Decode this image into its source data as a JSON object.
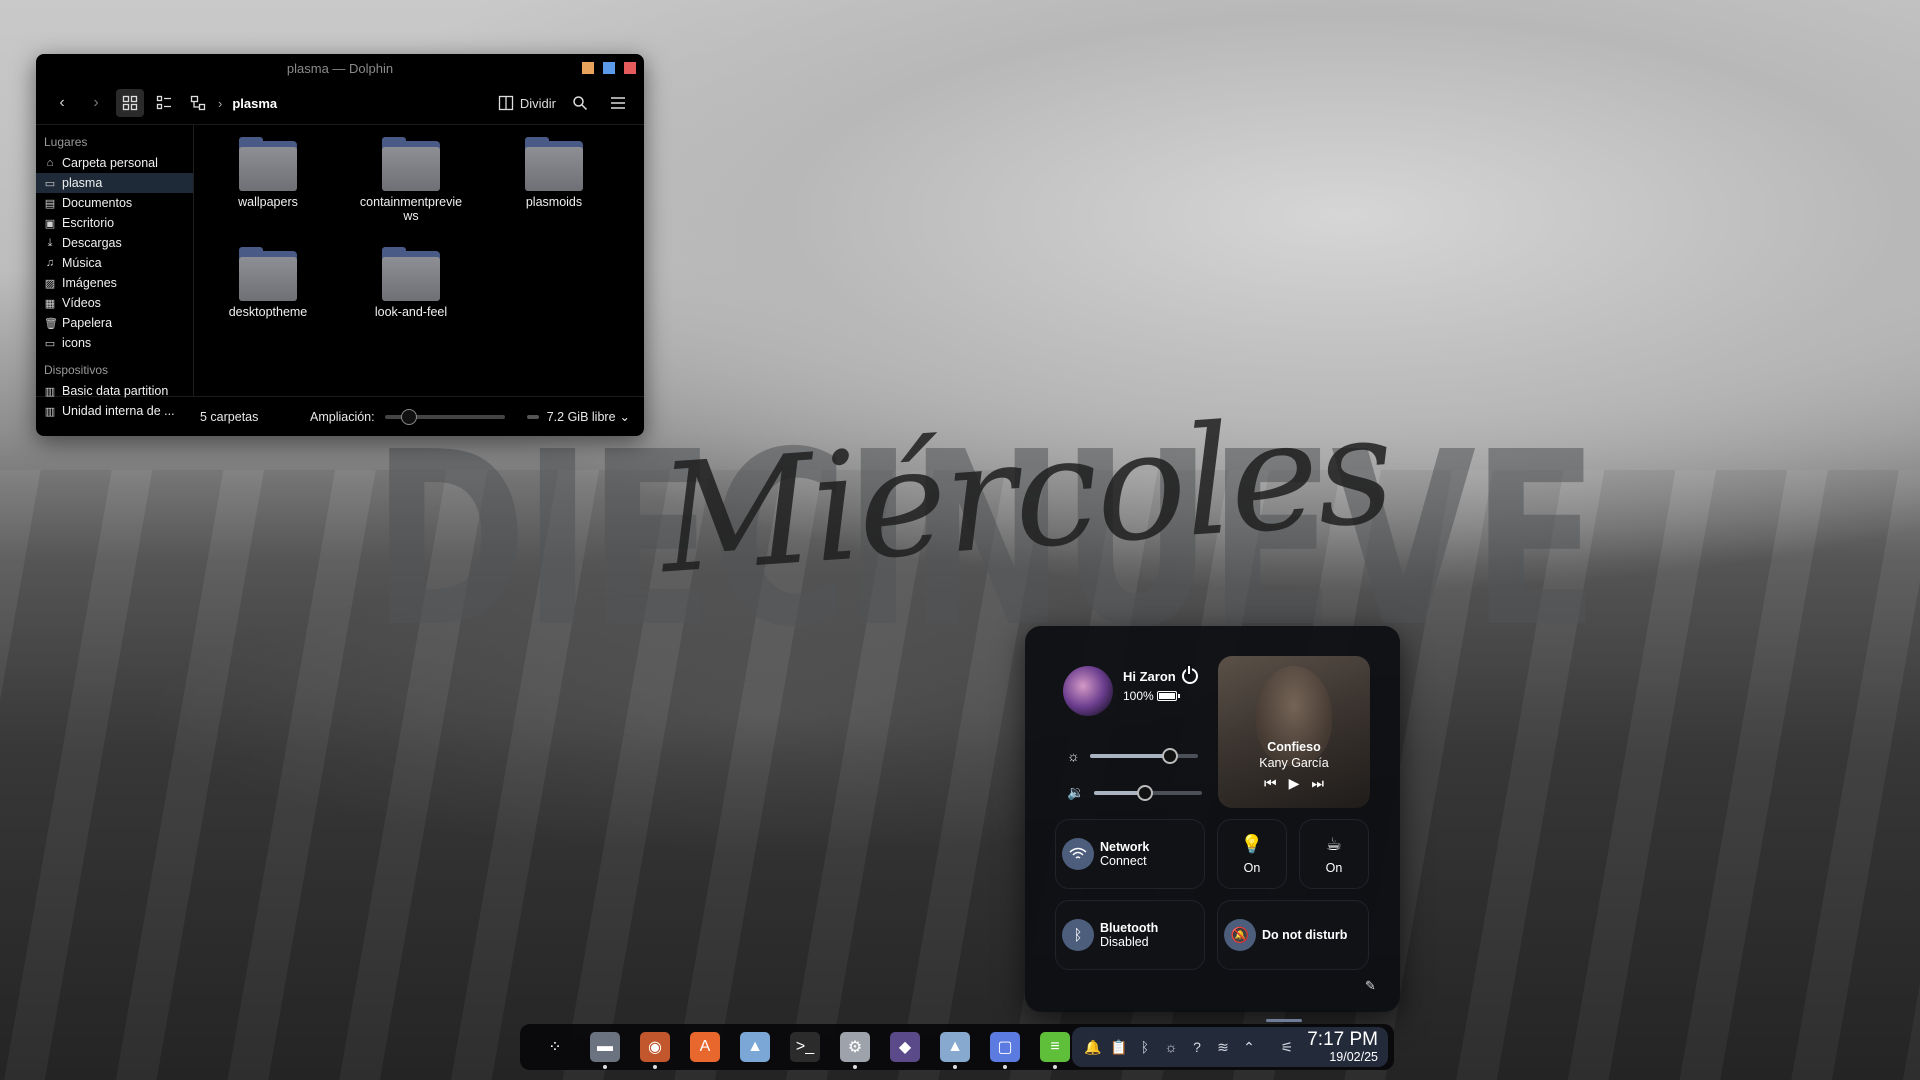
{
  "wallpaper": {
    "big_text": "DIECINUEVE",
    "script_text": "Miércoles"
  },
  "dolphin": {
    "title": "plasma — Dolphin",
    "window_colors": [
      "#e9a25b",
      "#5b9be9",
      "#e55b5b"
    ],
    "breadcrumb": "plasma",
    "split_label": "Dividir",
    "places_heading": "Lugares",
    "places": [
      {
        "label": "Carpeta personal",
        "icon": "home-icon",
        "selected": false
      },
      {
        "label": "plasma",
        "icon": "folder-icon",
        "selected": true
      },
      {
        "label": "Documentos",
        "icon": "document-icon",
        "selected": false
      },
      {
        "label": "Escritorio",
        "icon": "desktop-icon",
        "selected": false
      },
      {
        "label": "Descargas",
        "icon": "download-icon",
        "selected": false
      },
      {
        "label": "Música",
        "icon": "music-icon",
        "selected": false
      },
      {
        "label": "Imágenes",
        "icon": "image-icon",
        "selected": false
      },
      {
        "label": "Vídeos",
        "icon": "video-icon",
        "selected": false
      },
      {
        "label": "Papelera",
        "icon": "trash-icon",
        "selected": false
      },
      {
        "label": "icons",
        "icon": "folder-icon",
        "selected": false
      }
    ],
    "devices_heading": "Dispositivos",
    "devices": [
      {
        "label": "Basic data partition",
        "icon": "drive-icon"
      },
      {
        "label": "Unidad interna de ...",
        "icon": "drive-icon"
      }
    ],
    "folders": [
      {
        "name": "wallpapers"
      },
      {
        "name": "containmentpreviews",
        "line1": "containmentprevie",
        "line2": "ws"
      },
      {
        "name": "plasmoids"
      },
      {
        "name": "desktoptheme"
      },
      {
        "name": "look-and-feel"
      }
    ],
    "status_count": "5 carpetas",
    "zoom_label": "Ampliación:",
    "zoom_level": 0.2,
    "free_space": "7.2 GiB libre"
  },
  "control_center": {
    "greeting": "Hi Zaron",
    "battery": "100%",
    "brightness_level": 0.74,
    "volume_level": 0.47,
    "media": {
      "song": "Confieso",
      "artist": "Kany García"
    },
    "network": {
      "title": "Network",
      "subtitle": "Connect"
    },
    "lightbulb_state": "On",
    "caffeine_state": "On",
    "bluetooth": {
      "title": "Bluetooth",
      "subtitle": "Disabled"
    },
    "dnd_label": "Do not disturb",
    "accent": "#4d5d7c"
  },
  "dock": {
    "apps": [
      {
        "name": "launcher",
        "color": "transparent",
        "glyph": "⁘",
        "running": false
      },
      {
        "name": "files",
        "color": "#6b7280",
        "glyph": "▬",
        "running": true
      },
      {
        "name": "firefox",
        "color": "#c2562c",
        "glyph": "◉",
        "running": true
      },
      {
        "name": "store",
        "color": "#e8672c",
        "glyph": "A",
        "running": false
      },
      {
        "name": "image-viewer",
        "color": "#7aa7d6",
        "glyph": "▲",
        "running": false
      },
      {
        "name": "terminal",
        "color": "#2b2b2b",
        "glyph": ">_",
        "running": false
      },
      {
        "name": "settings",
        "color": "#9ea3ab",
        "glyph": "⚙",
        "running": true
      },
      {
        "name": "obsidian",
        "color": "#5b4a8a",
        "glyph": "◆",
        "running": false
      },
      {
        "name": "gallery",
        "color": "#87a9cf",
        "glyph": "▲",
        "running": true
      },
      {
        "name": "screenshot",
        "color": "#5b7be0",
        "glyph": "▢",
        "running": true
      },
      {
        "name": "spotify",
        "color": "#5fbf3a",
        "glyph": "≡",
        "running": true
      }
    ],
    "clock_time": "7:17 PM",
    "clock_date": "19/02/25"
  }
}
